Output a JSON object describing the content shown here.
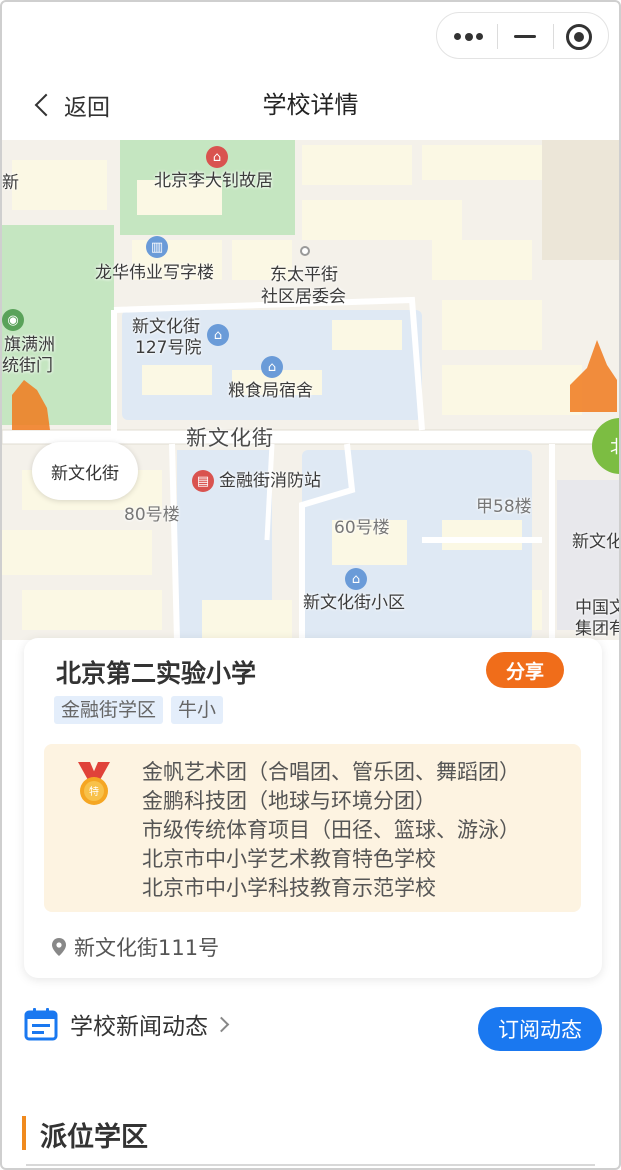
{
  "capsule": {
    "more_icon": "more-dots-icon",
    "minimize_icon": "minimize-icon",
    "close_icon": "target-icon"
  },
  "nav": {
    "back_label": "返回",
    "title": "学校详情"
  },
  "map": {
    "labels": {
      "li_dazhao": "北京李大钊故居",
      "longhua": "龙华伟业写字楼",
      "dongtaiping_1": "东太平街",
      "dongtaiping_2": "社区居委会",
      "xinwenhua127_1": "新文化街",
      "xinwenhua127_2": "127号院",
      "liangshiju": "粮食局宿舍",
      "xinwenhua_street": "新文化街",
      "xinwenhua_bubble": "新文化街",
      "fire_station": "金融街消防站",
      "bldg80": "80号楼",
      "bldg60": "60号楼",
      "bldg58": "甲58楼",
      "xinwenhua_community": "新文化街小区",
      "qiman_1": "旗满洲",
      "qiman_2": "统街门",
      "left_edge": "新",
      "right_1": "新文化",
      "right_2": "中国文",
      "right_3": "集团有",
      "right_circle": "北"
    }
  },
  "school": {
    "name": "北京第二实验小学",
    "share_label": "分享",
    "tags": [
      "金融街学区",
      "牛小"
    ],
    "honors": [
      "金帆艺术团（合唱团、管乐团、舞蹈团）",
      "金鹏科技团（地球与环境分团）",
      "市级传统体育项目（田径、篮球、游泳）",
      "北京市中小学艺术教育特色学校",
      "北京市中小学科技教育示范学校"
    ],
    "address": "新文化街111号"
  },
  "news": {
    "label": "学校新闻动态",
    "subscribe_label": "订阅动态"
  },
  "section": {
    "title": "派位学区"
  },
  "colors": {
    "accent_orange": "#f06d1a",
    "accent_blue": "#1a78f0",
    "section_bar": "#f08a1e",
    "honor_bg": "#fdf3e1",
    "tag_bg": "#e4eefb"
  }
}
